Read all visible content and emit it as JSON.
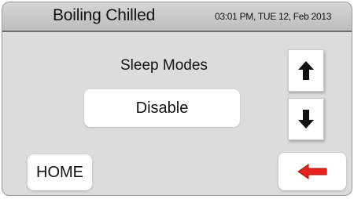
{
  "header": {
    "title": "Boiling Chilled",
    "datetime": "03:01 PM, TUE 12, Feb 2013"
  },
  "panel": {
    "title": "Sleep Modes",
    "value": "Disable"
  },
  "controls": {
    "up_icon": "arrow-up-icon",
    "down_icon": "arrow-down-icon",
    "back_icon": "back-arrow-icon",
    "home_label": "HOME"
  },
  "colors": {
    "screen_bg": "#dcdcdc",
    "header_bg": "#c8c8c8",
    "button_bg": "#ffffff",
    "back_arrow": "#e8231c",
    "arrow_fill": "#111111"
  }
}
